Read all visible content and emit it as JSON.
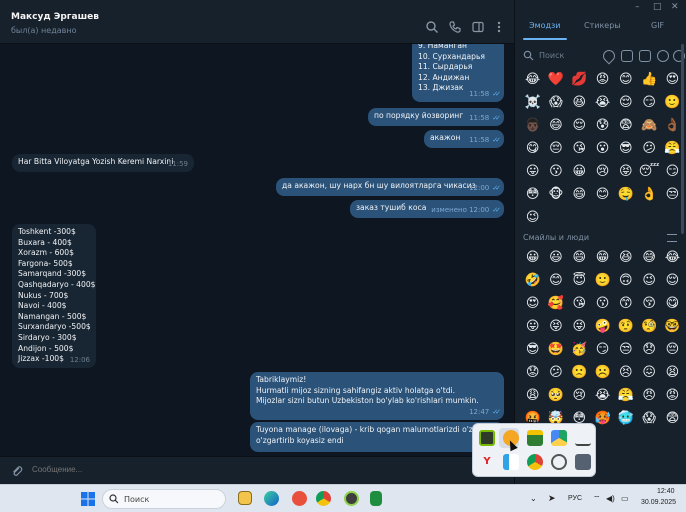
{
  "window": {
    "minimize_glyph": "–",
    "maximize_glyph": "□",
    "close_glyph": "✕"
  },
  "chat": {
    "contact_name": "Максуд Эргашев",
    "contact_status": "был(а) недавно",
    "messages": [
      {
        "dir": "out",
        "text": "9. Наманган\n10. Сурхандарья\n11. Сырдарья\n12. Андижан\n13. Джизак",
        "time": "11:58"
      },
      {
        "dir": "out",
        "text": "по порядку йозворинг",
        "time": "11:58"
      },
      {
        "dir": "out",
        "text": "акажон",
        "time": "11:58"
      },
      {
        "dir": "in",
        "text": "Har Bitta Viloyatga Yozish Keremi Narxini",
        "time": "11:59"
      },
      {
        "dir": "out",
        "text": "да акажон, шу нарх бн шу вилоятларга чикасиз",
        "time": "12:00"
      },
      {
        "dir": "out",
        "text": "заказ тушиб коса",
        "time": "изменено 12:00"
      },
      {
        "dir": "in",
        "text": "Toshkent -300$\nBuxara - 400$\nXorazm - 600$\nFargona- 500$\nSamarqand -300$\nQashqadaryo - 400$\nNukus - 700$\nNavoi - 400$\nNamangan - 500$\nSurxandaryo -500$\nSirdaryo - 300$\nAndijon - 500$\nJizzax -100$",
        "time": "12:06"
      },
      {
        "dir": "out",
        "text": "Tabriklaymiz!\nHurmatli mijoz sizning sahifangiz aktiv holatga o'tdi.\nMijozlar sizni butun Uzbekiston bo'ylab ko'rishlari mumkin.",
        "time": "12:47"
      },
      {
        "dir": "out",
        "text": "Tuyona manage (ilovaga) - krib qogan malumotlarizdi o'ziz\no'zgartirib koyasiz endi",
        "time": "12"
      }
    ],
    "composer_placeholder": "Сообщение..."
  },
  "emoji_panel": {
    "tabs": [
      "Эмодзи",
      "Стикеры",
      "GIF"
    ],
    "active_tab": "Эмодзи",
    "search_placeholder": "Поиск",
    "recent": [
      "😂",
      "❤️",
      "💋",
      "😡",
      "😊",
      "👍",
      "😍",
      "☠️",
      "😱",
      "😆",
      "😭",
      "😌",
      "😏",
      "🙂",
      "👨🏿",
      "😄",
      "😌",
      "😰",
      "😨",
      "🙈",
      "👌🏾",
      "😋",
      "😔",
      "😘",
      "😮",
      "😎",
      "😕",
      "😤",
      "😛",
      "😗",
      "😀",
      "😢",
      "😝",
      "😴",
      "😏",
      "😳",
      "🐵",
      "😄",
      "😊",
      "🤤",
      "👌",
      "😒",
      "😉"
    ],
    "section_title": "Смайлы и люди",
    "smileys": [
      "😀",
      "😃",
      "😄",
      "😁",
      "😆",
      "😅",
      "😂",
      "🤣",
      "😊",
      "😇",
      "🙂",
      "🙃",
      "😉",
      "😌",
      "😍",
      "🥰",
      "😘",
      "😗",
      "😙",
      "😚",
      "😋",
      "😛",
      "😝",
      "😜",
      "🤪",
      "🤨",
      "🧐",
      "🤓",
      "😎",
      "🤩",
      "🥳",
      "😏",
      "😒",
      "😞",
      "😔",
      "😟",
      "😕",
      "🙁",
      "☹️",
      "😣",
      "😖",
      "😫",
      "😩",
      "🥺",
      "😢",
      "😭",
      "😤",
      "😠",
      "😡",
      "🤬",
      "🤯",
      "😳",
      "🥵",
      "🥶",
      "😱",
      "😨"
    ]
  },
  "tray_popup": {
    "icons": [
      "nvidia-icon",
      "dropbox-like-icon",
      "stack-icon",
      "drive-icon",
      "usb-icon",
      "yandex-icon",
      "telegram-icon",
      "chrome-icon",
      "link-icon",
      "screen-icon"
    ]
  },
  "taskbar": {
    "search_label": "Поиск",
    "language": "РУС",
    "time": "12:40",
    "date": "30.09.2025"
  },
  "colors": {
    "chat_bg": "#0e1621",
    "header_bg": "#17212b",
    "bubble_out": "#2b5278",
    "bubble_in": "#182533",
    "accent": "#6ab2f2",
    "taskbar_bg": "#dfe6ef"
  }
}
